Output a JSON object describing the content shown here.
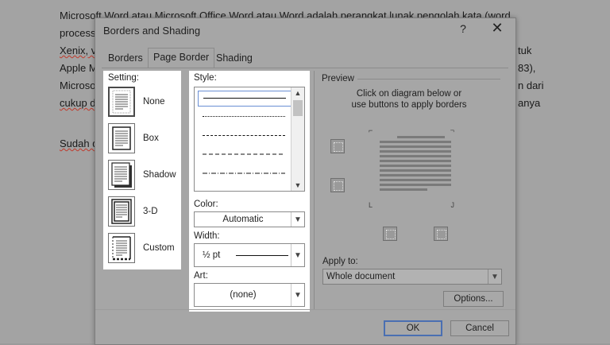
{
  "document": {
    "lines": [
      "Microsoft Word atau Microsoft Office Word atau Word adalah perangkat lunak pengolah kata (word",
      "process",
      "Xenix, v",
      "Apple M",
      "Microsof",
      "cukup d",
      "Sudah d"
    ],
    "right_fragments": [
      "tuk",
      "83),",
      "n dari",
      "anya"
    ]
  },
  "dialog": {
    "title": "Borders and Shading",
    "help_glyph": "?",
    "close_glyph": "✕",
    "tabs": [
      {
        "label": "Borders",
        "active": false
      },
      {
        "label": "Page Border",
        "active": true
      },
      {
        "label": "Shading",
        "active": false
      }
    ]
  },
  "setting": {
    "label": "Setting:",
    "items": [
      {
        "label": "None",
        "icon": "none-setting-icon",
        "selected": true
      },
      {
        "label": "Box",
        "icon": "box-setting-icon",
        "selected": false
      },
      {
        "label": "Shadow",
        "icon": "shadow-setting-icon",
        "selected": false
      },
      {
        "label": "3-D",
        "icon": "3d-setting-icon",
        "selected": false
      },
      {
        "label": "Custom",
        "icon": "custom-setting-icon",
        "selected": false
      }
    ]
  },
  "style": {
    "label": "Style:",
    "items": [
      "solid",
      "dotted",
      "dashed-short",
      "dashed",
      "dash-dot"
    ],
    "color_label": "Color:",
    "color_value": "Automatic",
    "width_label": "Width:",
    "width_value": "½ pt",
    "art_label": "Art:",
    "art_value": "(none)"
  },
  "preview": {
    "label": "Preview",
    "hint_line1": "Click on diagram below or",
    "hint_line2": "use buttons to apply borders"
  },
  "apply": {
    "label": "Apply to:",
    "value": "Whole document"
  },
  "buttons": {
    "options": "Options...",
    "ok": "OK",
    "cancel": "Cancel"
  },
  "colors": {
    "overlay_gray": "#a6a6a6",
    "panel_white": "#ffffff",
    "primary_border": "#4a6fb2"
  }
}
